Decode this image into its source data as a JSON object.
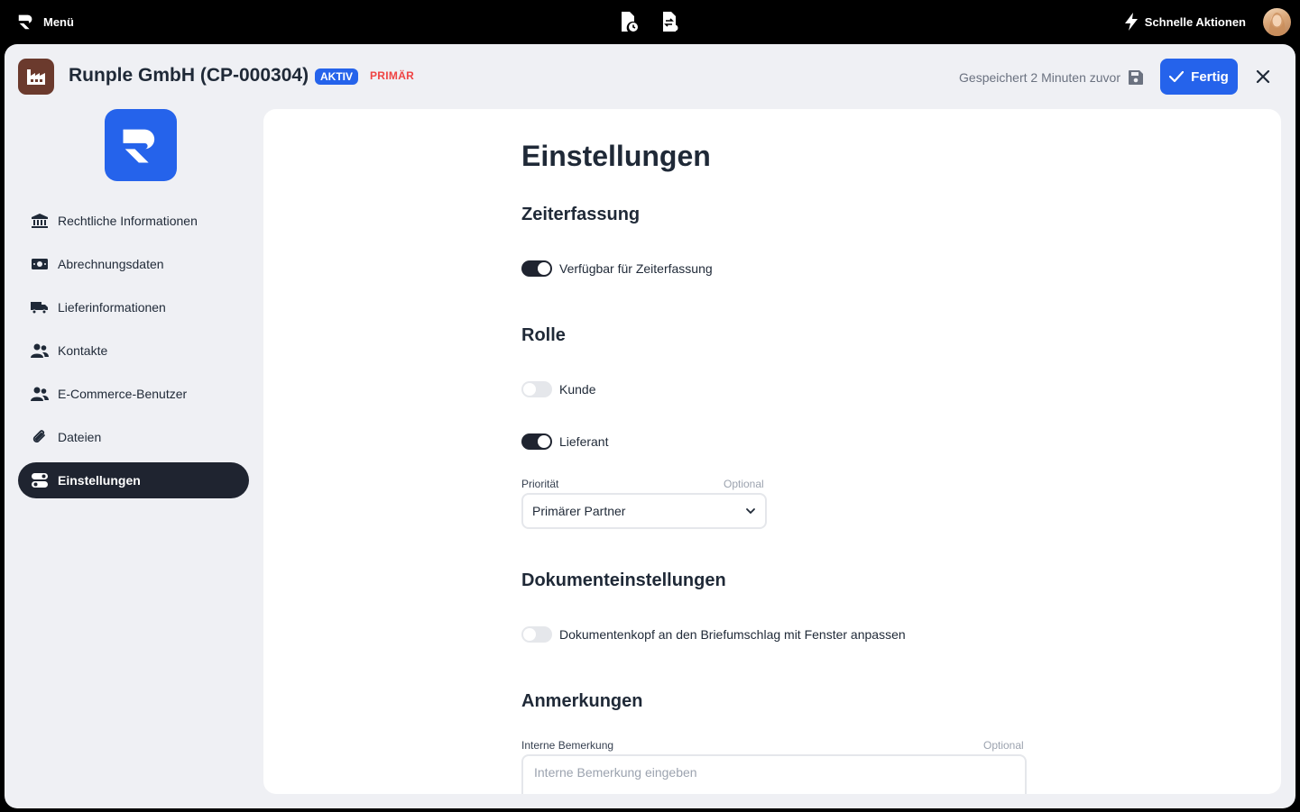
{
  "topbar": {
    "menu_label": "Menü",
    "quick_actions_label": "Schnelle Aktionen",
    "center_icons": [
      "file-clock-icon",
      "file-exchange-icon"
    ]
  },
  "header": {
    "title": "Runple GmbH (CP-000304)",
    "badge_active": "AKTIV",
    "badge_primary": "PRIMÄR",
    "saved_text": "Gespeichert 2 Minuten zuvor",
    "done_label": "Fertig"
  },
  "sidebar": {
    "items": [
      {
        "label": "Rechtliche Informationen",
        "icon": "bank-icon"
      },
      {
        "label": "Abrechnungsdaten",
        "icon": "money-bill-icon"
      },
      {
        "label": "Lieferinformationen",
        "icon": "truck-icon"
      },
      {
        "label": "Kontakte",
        "icon": "users-icon"
      },
      {
        "label": "E-Commerce-Benutzer",
        "icon": "users-icon"
      },
      {
        "label": "Dateien",
        "icon": "paperclip-icon"
      },
      {
        "label": "Einstellungen",
        "icon": "toggles-icon",
        "active": true
      }
    ]
  },
  "main": {
    "title": "Einstellungen",
    "time_tracking": {
      "heading": "Zeiterfassung",
      "toggle_label": "Verfügbar für Zeiterfassung",
      "enabled": true
    },
    "role": {
      "heading": "Rolle",
      "customer_label": "Kunde",
      "customer_enabled": false,
      "supplier_label": "Lieferant",
      "supplier_enabled": true,
      "priority_label": "Priorität",
      "priority_optional": "Optional",
      "priority_value": "Primärer Partner"
    },
    "documents": {
      "heading": "Dokumenteinstellungen",
      "toggle_label": "Dokumentenkopf an den Briefumschlag mit Fenster anpassen",
      "enabled": false
    },
    "notes": {
      "heading": "Anmerkungen",
      "field_label": "Interne Bemerkung",
      "field_optional": "Optional",
      "placeholder": "Interne Bemerkung eingeben",
      "value": ""
    }
  },
  "colors": {
    "accent": "#2563eb",
    "active_nav": "#1f2430",
    "primary_badge": "#ef4444",
    "company_icon_bg": "#6b3a2d"
  }
}
